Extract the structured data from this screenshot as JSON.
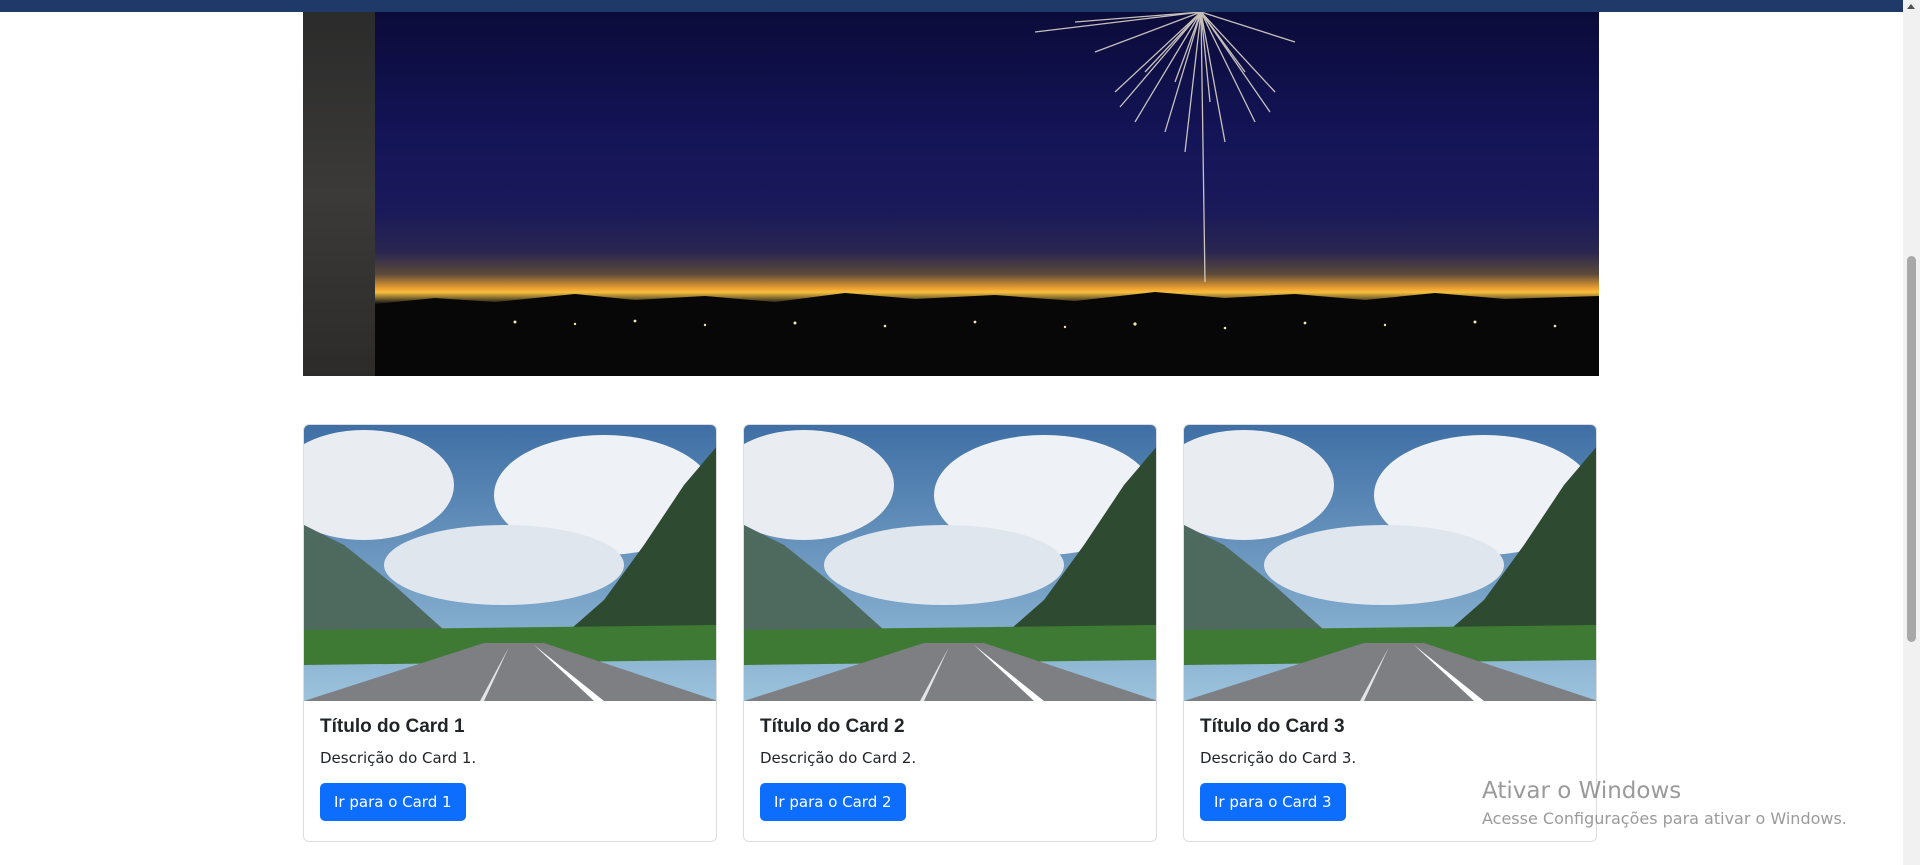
{
  "hero": {
    "image_icon": "fireworks-night-photo"
  },
  "cards": [
    {
      "title": "Título do Card 1",
      "text": "Descrição do Card 1.",
      "button": "Ir para o Card 1",
      "image_icon": "mountain-road-photo"
    },
    {
      "title": "Título do Card 2",
      "text": "Descrição do Card 2.",
      "button": "Ir para o Card 2",
      "image_icon": "mountain-road-photo"
    },
    {
      "title": "Título do Card 3",
      "text": "Descrição do Card 3.",
      "button": "Ir para o Card 3",
      "image_icon": "mountain-road-photo"
    }
  ],
  "watermark": {
    "title": "Ativar o Windows",
    "subtitle": "Acesse Configurações para ativar o Windows."
  },
  "colors": {
    "button": "#0d6efd",
    "topbar": "#1f3a68"
  }
}
